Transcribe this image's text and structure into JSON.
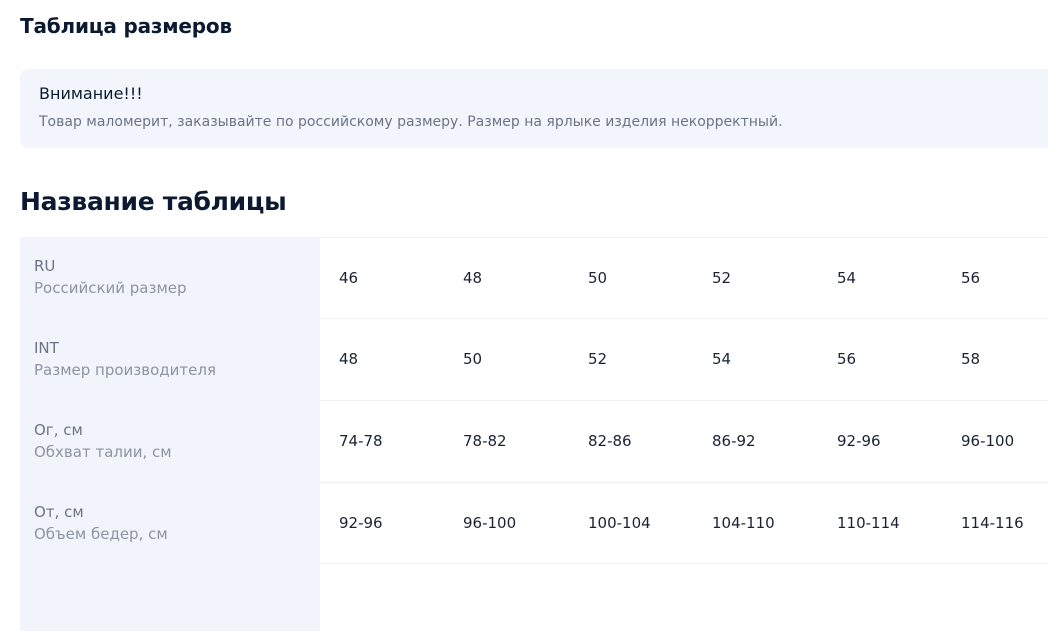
{
  "page": {
    "section_title": "Таблица размеров"
  },
  "notice": {
    "title": "Внимание!!!",
    "text": "Товар маломерит, заказывайте по российскому размеру. Размер на ярлыке изделия некорректный."
  },
  "table": {
    "title": "Название таблицы",
    "rows": [
      {
        "code": "RU",
        "description": "Российский размер",
        "values": [
          "46",
          "48",
          "50",
          "52",
          "54",
          "56"
        ]
      },
      {
        "code": "INT",
        "description": "Размер производителя",
        "values": [
          "48",
          "50",
          "52",
          "54",
          "56",
          "58"
        ]
      },
      {
        "code": "Ог, см",
        "description": "Обхват талии, см",
        "values": [
          "74-78",
          "78-82",
          "82-86",
          "86-92",
          "92-96",
          "96-100"
        ]
      },
      {
        "code": "От, см",
        "description": "Объем бедер, см",
        "values": [
          "92-96",
          "96-100",
          "100-104",
          "104-110",
          "110-114",
          "114-116"
        ]
      }
    ]
  }
}
